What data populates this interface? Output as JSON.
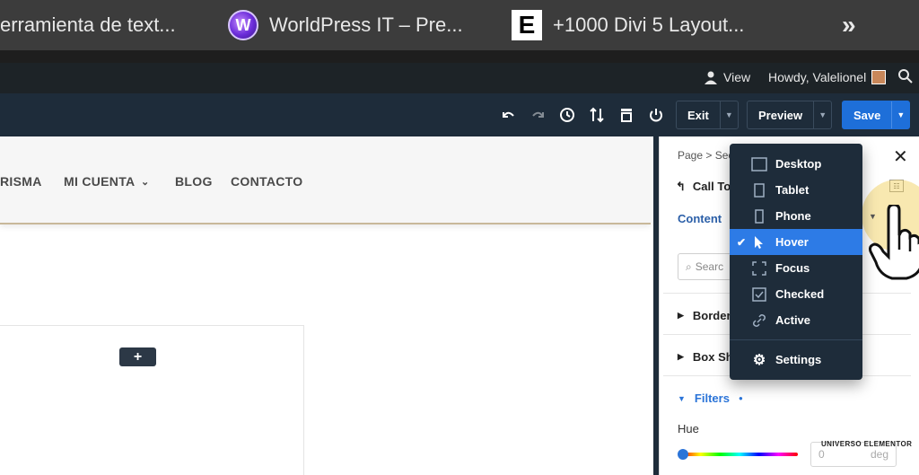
{
  "browser": {
    "tabs": [
      {
        "title": "erramienta de text..."
      },
      {
        "title": "WorldPress IT – Pre..."
      },
      {
        "title": "+1000 Divi 5 Layout..."
      }
    ],
    "overflow": "»"
  },
  "adminbar": {
    "view_label": "View",
    "howdy": "Howdy, Valelionel"
  },
  "toolbar": {
    "exit_label": "Exit",
    "preview_label": "Preview",
    "save_label": "Save"
  },
  "site": {
    "menu": [
      "RISMA",
      "MI CUENTA",
      "BLOG",
      "CONTACTO"
    ],
    "add_label": "+"
  },
  "panel": {
    "breadcrumb": "Page > Sec",
    "back_label": "Call To",
    "tab_content": "Content",
    "search_placeholder": "Searc",
    "sections": [
      "Border",
      "Box Sha",
      "Filters"
    ],
    "hue_label": "Hue",
    "hue_value": "0",
    "hue_unit": "deg",
    "watermark": "UNIVERSO ELEMENTOR"
  },
  "dropdown": {
    "items": [
      {
        "label": "Desktop",
        "icon": "desktop-icon"
      },
      {
        "label": "Tablet",
        "icon": "tablet-icon"
      },
      {
        "label": "Phone",
        "icon": "phone-icon"
      },
      {
        "label": "Hover",
        "icon": "cursor-icon",
        "selected": true
      },
      {
        "label": "Focus",
        "icon": "focus-icon"
      },
      {
        "label": "Checked",
        "icon": "checkbox-icon"
      },
      {
        "label": "Active",
        "icon": "link-icon"
      }
    ],
    "settings_label": "Settings"
  },
  "colors": {
    "accent": "#2d7be6",
    "toolbar_bg": "#1e2c3a",
    "menu_bg": "#1e2c3a"
  }
}
